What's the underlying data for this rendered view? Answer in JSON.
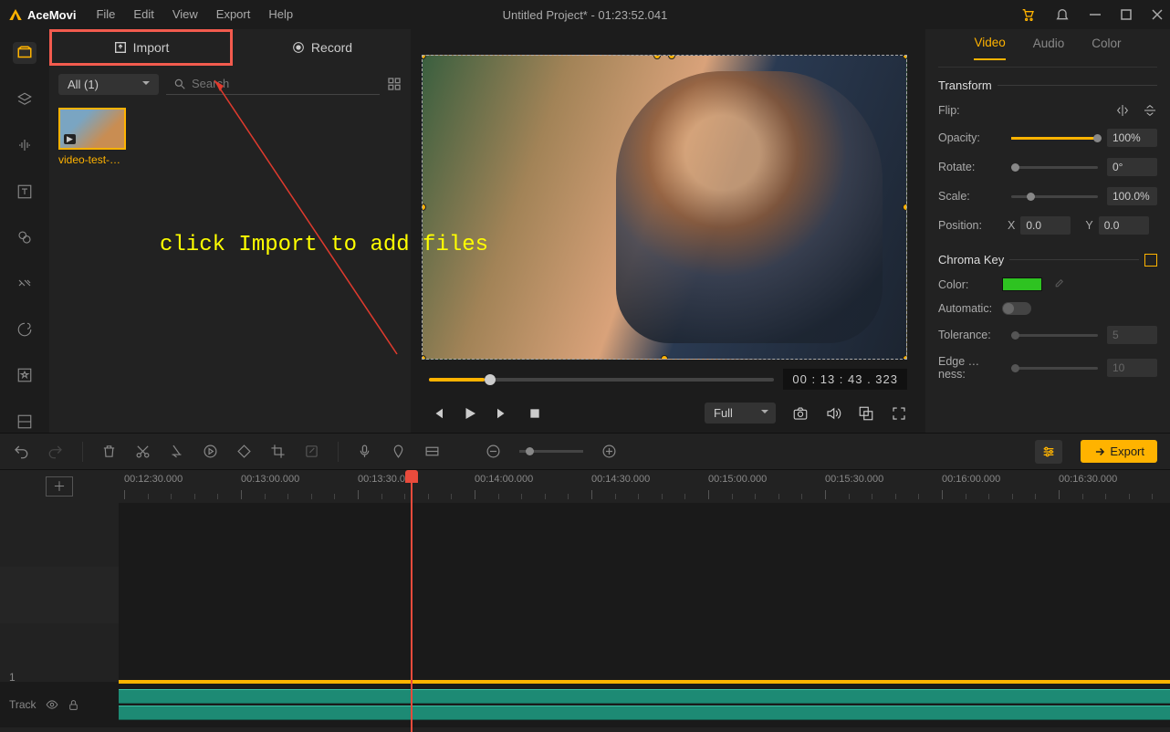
{
  "app": {
    "name": "AceMovi",
    "title": "Untitled Project* - 01:23:52.041"
  },
  "menu": {
    "file": "File",
    "edit": "Edit",
    "view": "View",
    "export": "Export",
    "help": "Help"
  },
  "library": {
    "import_label": "Import",
    "record_label": "Record",
    "filter_label": "All (1)",
    "search_placeholder": "Search",
    "thumb_label": "video-test-c…"
  },
  "annotation": "click Import to add files",
  "preview": {
    "time": "00 : 13 : 43 . 323",
    "full_label": "Full"
  },
  "props": {
    "tabs": {
      "video": "Video",
      "audio": "Audio",
      "color": "Color"
    },
    "transform_title": "Transform",
    "flip_label": "Flip:",
    "opacity_label": "Opacity:",
    "opacity_value": "100%",
    "rotate_label": "Rotate:",
    "rotate_value": "0°",
    "scale_label": "Scale:",
    "scale_value": "100.0%",
    "position_label": "Position:",
    "pos_x_lbl": "X",
    "pos_x_value": "0.0",
    "pos_y_lbl": "Y",
    "pos_y_value": "0.0",
    "chroma_title": "Chroma Key",
    "color_label": "Color:",
    "auto_label": "Automatic:",
    "tol_label": "Tolerance:",
    "tol_value": "5",
    "edge_label": "Edge …ness:",
    "edge_value": "10"
  },
  "toolbar": {
    "export_label": "Export"
  },
  "timeline": {
    "ticks": [
      "00:12:30.000",
      "00:13:00.000",
      "00:13:30.000",
      "00:14:00.000",
      "00:14:30.000",
      "00:15:00.000",
      "00:15:30.000",
      "00:16:00.000",
      "00:16:30.000"
    ],
    "track_number": "1",
    "track_label": "Track"
  }
}
